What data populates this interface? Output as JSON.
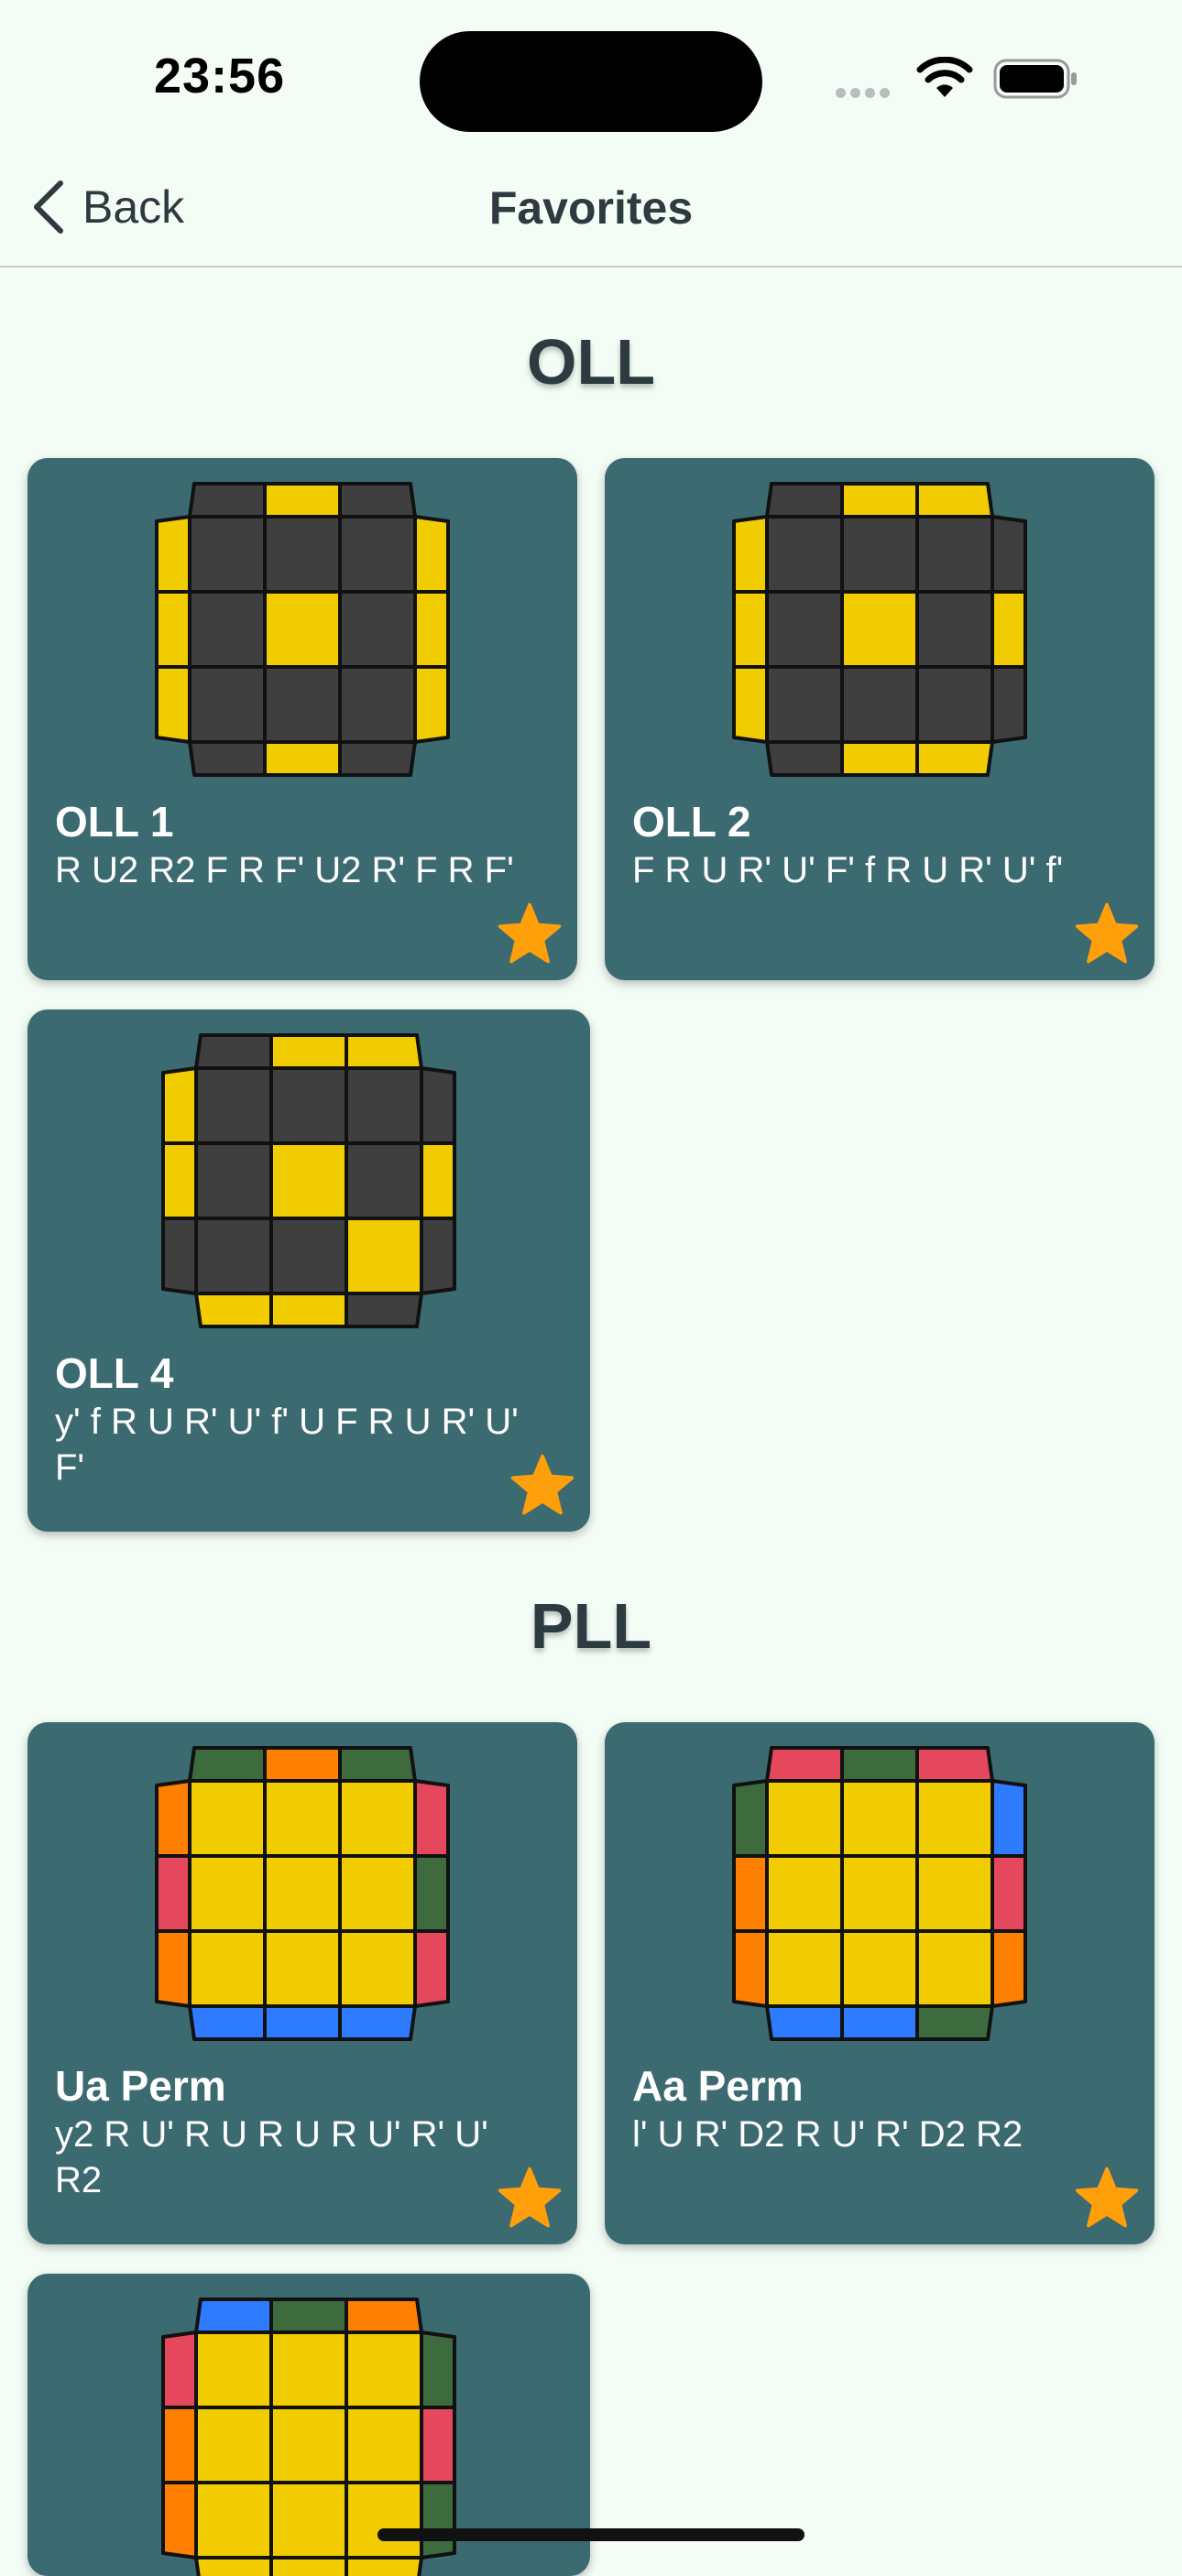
{
  "status_bar": {
    "time": "23:56"
  },
  "nav": {
    "back_label": "Back",
    "title": "Favorites"
  },
  "colors": {
    "background": "#f3fdf5",
    "card": "#3c6a71",
    "star": "#ff9f0a",
    "cube_dark": "#3f3f3f",
    "cube_yellow": "#f0cc00",
    "cube_red": "#e5485c",
    "cube_green": "#3d6b3e",
    "cube_orange": "#ff8000",
    "cube_blue": "#2f7bff"
  },
  "sections": [
    {
      "title": "OLL",
      "cards": [
        {
          "name": "OLL 1",
          "alg": "R U2 R2 F R F' U2 R' F R F'",
          "favorite_icon": "star-icon",
          "cube": {
            "top": [
              "D",
              "Y",
              "D"
            ],
            "left": [
              "Y",
              "Y",
              "Y"
            ],
            "right": [
              "Y",
              "Y",
              "Y"
            ],
            "bottom": [
              "D",
              "Y",
              "D"
            ],
            "face": [
              [
                "D",
                "D",
                "D"
              ],
              [
                "D",
                "Y",
                "D"
              ],
              [
                "D",
                "D",
                "D"
              ]
            ]
          }
        },
        {
          "name": "OLL 2",
          "alg": "F R U R' U' F' f R U R' U' f'",
          "favorite_icon": "star-icon",
          "cube": {
            "top": [
              "D",
              "Y",
              "Y"
            ],
            "left": [
              "Y",
              "Y",
              "Y"
            ],
            "right": [
              "D",
              "Y",
              "D"
            ],
            "bottom": [
              "D",
              "Y",
              "Y"
            ],
            "face": [
              [
                "D",
                "D",
                "D"
              ],
              [
                "D",
                "Y",
                "D"
              ],
              [
                "D",
                "D",
                "D"
              ]
            ]
          }
        },
        {
          "name": "OLL 4",
          "alg": "y' f R U R' U' f' U F R U R' U' F'",
          "favorite_icon": "star-icon",
          "cube": {
            "top": [
              "D",
              "Y",
              "Y"
            ],
            "left": [
              "Y",
              "Y",
              "D"
            ],
            "right": [
              "D",
              "Y",
              "D"
            ],
            "bottom": [
              "Y",
              "Y",
              "D"
            ],
            "face": [
              [
                "D",
                "D",
                "D"
              ],
              [
                "D",
                "Y",
                "D"
              ],
              [
                "D",
                "D",
                "Y"
              ]
            ]
          }
        }
      ]
    },
    {
      "title": "PLL",
      "cards": [
        {
          "name": "Ua Perm",
          "alg": "y2 R U' R U R U R U' R' U' R2",
          "favorite_icon": "star-icon",
          "cube": {
            "top": [
              "G",
              "O",
              "G"
            ],
            "left": [
              "O",
              "R",
              "O"
            ],
            "right": [
              "R",
              "G",
              "R"
            ],
            "bottom": [
              "B",
              "B",
              "B"
            ],
            "face": [
              [
                "Y",
                "Y",
                "Y"
              ],
              [
                "Y",
                "Y",
                "Y"
              ],
              [
                "Y",
                "Y",
                "Y"
              ]
            ]
          }
        },
        {
          "name": "Aa Perm",
          "alg": "l' U R' D2 R U' R' D2 R2",
          "favorite_icon": "star-icon",
          "cube": {
            "top": [
              "R",
              "G",
              "R"
            ],
            "left": [
              "G",
              "O",
              "O"
            ],
            "right": [
              "B",
              "R",
              "O"
            ],
            "bottom": [
              "B",
              "B",
              "G"
            ],
            "face": [
              [
                "Y",
                "Y",
                "Y"
              ],
              [
                "Y",
                "Y",
                "Y"
              ],
              [
                "Y",
                "Y",
                "Y"
              ]
            ]
          }
        },
        {
          "name": "",
          "alg": "",
          "favorite_icon": "",
          "cube": {
            "top": [
              "B",
              "G",
              "O"
            ],
            "left": [
              "R",
              "O",
              "O"
            ],
            "right": [
              "G",
              "R",
              "G"
            ],
            "bottom": [
              "Y",
              "Y",
              "Y"
            ],
            "face": [
              [
                "Y",
                "Y",
                "Y"
              ],
              [
                "Y",
                "Y",
                "Y"
              ],
              [
                "Y",
                "Y",
                "Y"
              ]
            ]
          }
        }
      ]
    }
  ]
}
